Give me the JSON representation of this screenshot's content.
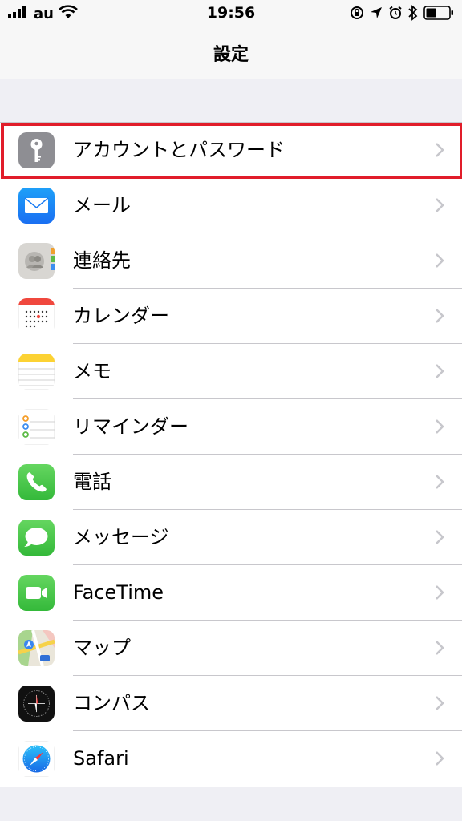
{
  "status_bar": {
    "carrier": "au",
    "time": "19:56",
    "icons": [
      "signal-icon",
      "wifi-icon",
      "orientation-lock-icon",
      "location-icon",
      "alarm-icon",
      "bluetooth-icon",
      "battery-icon"
    ]
  },
  "nav": {
    "title": "設定"
  },
  "settings": {
    "items": [
      {
        "label": "アカウントとパスワード",
        "icon": "key-icon"
      },
      {
        "label": "メール",
        "icon": "mail-icon"
      },
      {
        "label": "連絡先",
        "icon": "contacts-icon"
      },
      {
        "label": "カレンダー",
        "icon": "calendar-icon"
      },
      {
        "label": "メモ",
        "icon": "notes-icon"
      },
      {
        "label": "リマインダー",
        "icon": "reminders-icon"
      },
      {
        "label": "電話",
        "icon": "phone-icon"
      },
      {
        "label": "メッセージ",
        "icon": "messages-icon"
      },
      {
        "label": "FaceTime",
        "icon": "facetime-icon"
      },
      {
        "label": "マップ",
        "icon": "maps-icon"
      },
      {
        "label": "コンパス",
        "icon": "compass-icon"
      },
      {
        "label": "Safari",
        "icon": "safari-icon"
      }
    ]
  },
  "colors": {
    "highlight": "#e11d2a",
    "background": "#efeff4"
  }
}
